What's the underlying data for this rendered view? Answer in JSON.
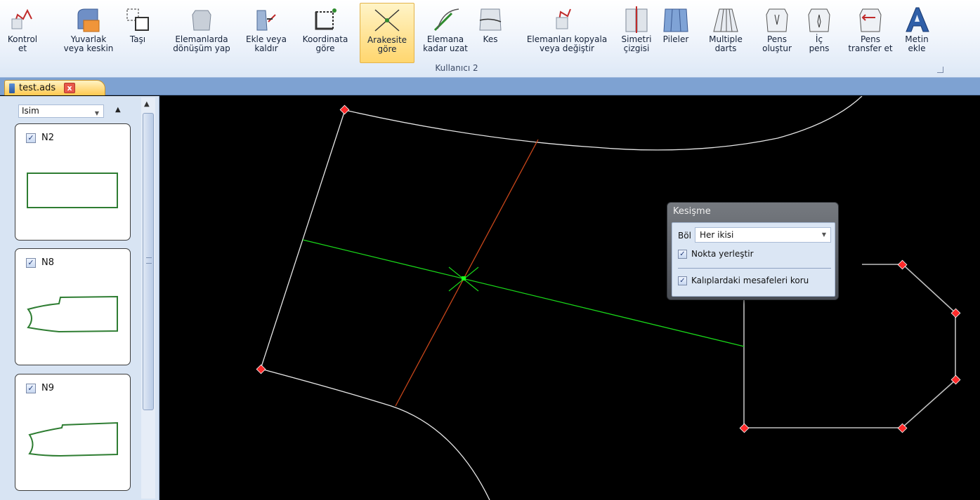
{
  "ribbon": {
    "buttons": [
      {
        "id": "kontrol",
        "label1": "Kontrol",
        "label2": "et",
        "icon": "check-shirt-icon"
      },
      {
        "id": "yuvarlak",
        "label1": "Yuvarlak",
        "label2": "veya keskin",
        "icon": "round-corner-icon"
      },
      {
        "id": "tasi",
        "label1": "Taşı",
        "label2": "",
        "icon": "move-icon"
      },
      {
        "id": "donusum",
        "label1": "Elemanlarda",
        "label2": "dönüşüm yap",
        "icon": "transform-icon"
      },
      {
        "id": "ekle",
        "label1": "Ekle veya",
        "label2": "kaldır",
        "icon": "add-remove-icon"
      },
      {
        "id": "koordinata",
        "label1": "Koordinata",
        "label2": "göre",
        "icon": "coordinate-icon"
      },
      {
        "id": "arakesite",
        "label1": "Arakesite",
        "label2": "göre",
        "icon": "intersection-icon"
      },
      {
        "id": "uzat",
        "label1": "Elemana",
        "label2": "kadar uzat",
        "icon": "extend-icon"
      },
      {
        "id": "kes",
        "label1": "Kes",
        "label2": "",
        "icon": "cut-icon"
      },
      {
        "id": "kopyala",
        "label1": "Elemanları kopyala",
        "label2": "veya değiştir",
        "icon": "copy-replace-icon"
      },
      {
        "id": "simetri",
        "label1": "Simetri",
        "label2": "çizgisi",
        "icon": "symmetry-icon"
      },
      {
        "id": "pileler",
        "label1": "Pileler",
        "label2": "",
        "icon": "pleats-icon"
      },
      {
        "id": "multiple",
        "label1": "Multiple",
        "label2": "darts",
        "icon": "multiple-darts-icon"
      },
      {
        "id": "pens",
        "label1": "Pens",
        "label2": "oluştur",
        "icon": "dart-create-icon"
      },
      {
        "id": "icpens",
        "label1": "İç",
        "label2": "pens",
        "icon": "inner-dart-icon"
      },
      {
        "id": "transfer",
        "label1": "Pens",
        "label2": "transfer et",
        "icon": "dart-transfer-icon"
      },
      {
        "id": "metin",
        "label1": "Metin",
        "label2": "ekle",
        "icon": "add-text-icon"
      }
    ],
    "group_label": "Kullanıcı 2",
    "active_button": "Arakesite göre"
  },
  "tabs": {
    "document": "test.ads",
    "close_glyph": "x"
  },
  "left_panel": {
    "sort_value": "Isim",
    "pieces": [
      {
        "name": "N2",
        "checked": true
      },
      {
        "name": "N8",
        "checked": true
      },
      {
        "name": "N9",
        "checked": true
      }
    ]
  },
  "dialog": {
    "title": "Kesişme",
    "bol_label": "Böl",
    "bol_value": "Her ikisi",
    "option1": "Nokta yerleştir",
    "option1_checked": true,
    "option2": "Kalıplardaki mesafeleri koru",
    "option2_checked": true
  },
  "colors": {
    "canvas_bg": "#000000",
    "pattern_line": "#e6e6e6",
    "green_line": "#19d619",
    "orange_line": "#c8461a",
    "point_marker": "#ff2a2a",
    "active_button": "#ffd66e"
  }
}
